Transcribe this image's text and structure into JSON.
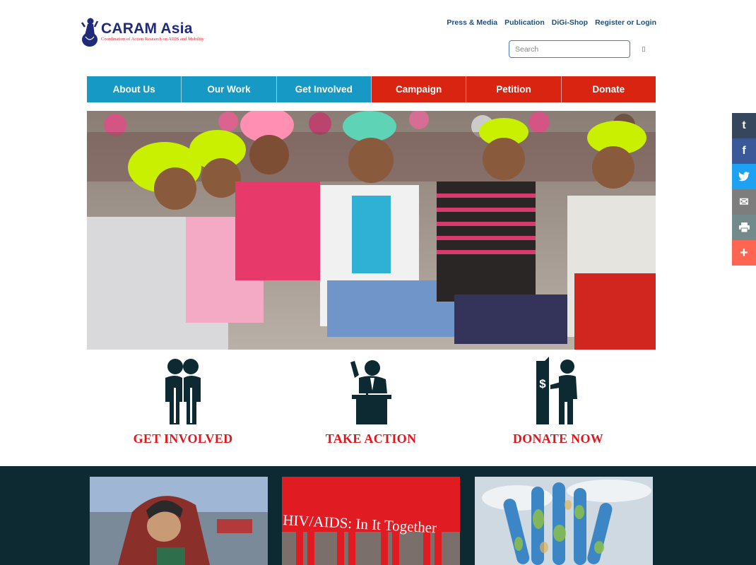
{
  "logo": {
    "title": "CARAM Asia",
    "subtitle": "Coordination of Action Research on AIDS and Mobility"
  },
  "toplinks": [
    "Press & Media",
    "Publication",
    "DiGi-Shop",
    "Register or Login"
  ],
  "search": {
    "placeholder": "Search",
    "button_icon": "search-icon"
  },
  "nav": [
    {
      "label": "About Us",
      "color": "#169ac5"
    },
    {
      "label": "Our Work",
      "color": "#169ac5"
    },
    {
      "label": "Get Involved",
      "color": "#169ac5"
    },
    {
      "label": "Campaign",
      "color": "#d92411"
    },
    {
      "label": "Petition",
      "color": "#d92411"
    },
    {
      "label": "Donate",
      "color": "#d92411"
    }
  ],
  "actions": [
    {
      "label": "GET INVOLVED",
      "icon": "people-icon"
    },
    {
      "label": "TAKE ACTION",
      "icon": "speaker-podium-icon"
    },
    {
      "label": "DONATE NOW",
      "icon": "donate-atm-icon"
    }
  ],
  "cards": [
    {
      "caption": "",
      "image": "man-with-blanket-photo"
    },
    {
      "caption": "HIV/AIDS: In It Together",
      "image": "hiv-banner-photo"
    },
    {
      "caption": "",
      "image": "painted-hands-photo"
    }
  ],
  "social": [
    {
      "name": "tumblr",
      "glyph": "t",
      "color": "#36465d"
    },
    {
      "name": "facebook",
      "glyph": "f",
      "color": "#3b5998"
    },
    {
      "name": "twitter",
      "glyph": "🐦",
      "color": "#1da1f2"
    },
    {
      "name": "email",
      "glyph": "✉",
      "color": "#7d7d7d"
    },
    {
      "name": "print",
      "glyph": "🖶",
      "color": "#738a8d"
    },
    {
      "name": "more",
      "glyph": "+",
      "color": "#ff6550"
    }
  ],
  "colors": {
    "nav_blue": "#169ac5",
    "nav_red": "#d92411",
    "action_red": "#e3141a",
    "band": "#0d2a33",
    "logo_blue": "#1f2a7a"
  }
}
